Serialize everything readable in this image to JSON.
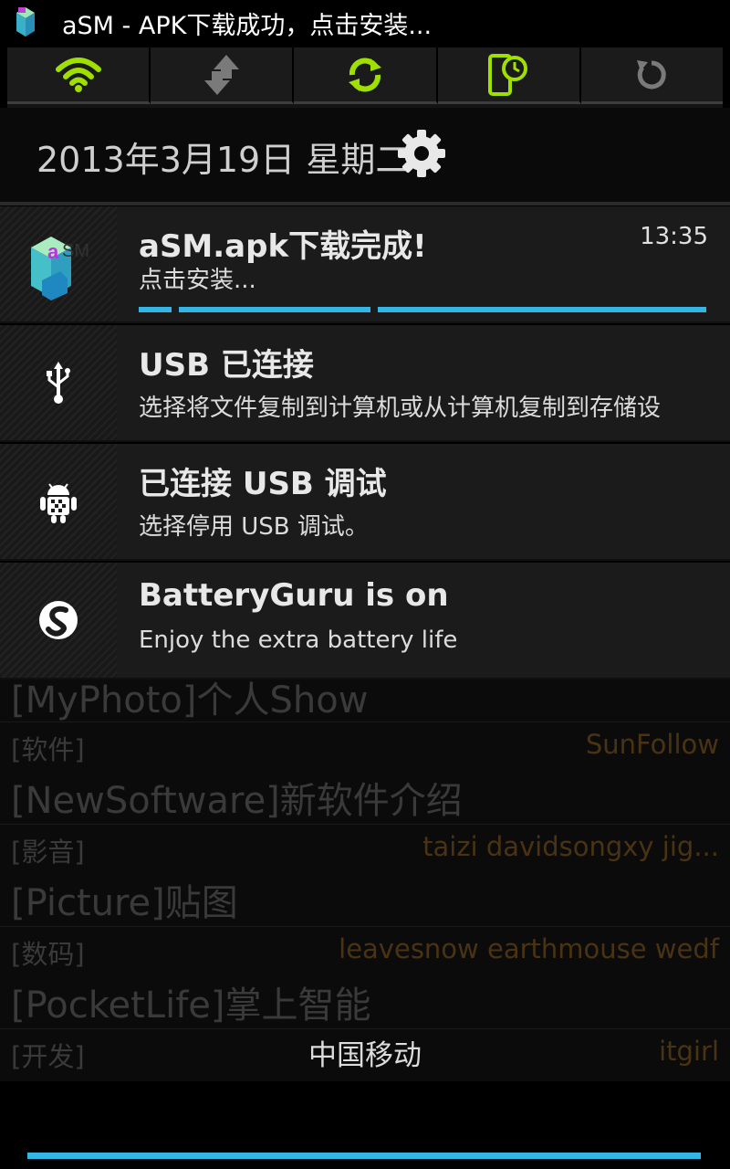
{
  "statusbar": {
    "icon": "asm-app-icon",
    "text": "aSM - APK下载成功，点击安装..."
  },
  "quick_settings": {
    "tiles": [
      {
        "icon": "wifi-icon",
        "color": "#a0e000"
      },
      {
        "icon": "data-transfer-icon",
        "color": "#7a7a7a"
      },
      {
        "icon": "sync-icon",
        "color": "#a0e000"
      },
      {
        "icon": "screen-timeout-icon",
        "color": "#a0e000"
      },
      {
        "icon": "auto-rotate-icon",
        "color": "#7a7a7a"
      }
    ]
  },
  "date": "2013年3月19日 星期二",
  "notifications": [
    {
      "icon": "asm-app-icon",
      "title": "aSM.apk下载完成!",
      "text": "点击安装...",
      "time": "13:35",
      "progress": 1.0
    },
    {
      "icon": "usb-icon",
      "title": "USB 已连接",
      "text": "选择将文件复制到计算机或从计算机复制到存储设"
    },
    {
      "icon": "android-debug-icon",
      "title": "已连接 USB 调试",
      "text": "选择停用 USB 调试。"
    },
    {
      "icon": "batteryguru-icon",
      "title": "BatteryGuru is on",
      "text": "Enjoy the extra battery life"
    }
  ],
  "background_app": {
    "rows": [
      {
        "title": "[MyPhoto]个人Show"
      },
      {
        "category": "[软件]",
        "users": "SunFollow"
      },
      {
        "title": "[NewSoftware]新软件介绍"
      },
      {
        "category": "[影音]",
        "users": "taizi davidsongxy jig..."
      },
      {
        "title": "[Picture]贴图"
      },
      {
        "category": "[数码]",
        "users": "leavesnow earthmouse wedf"
      },
      {
        "title": "[PocketLife]掌上智能"
      },
      {
        "category": "[开发]",
        "users": "itgirl"
      }
    ]
  },
  "carrier": "中国移动",
  "accent_color": "#33b5e5"
}
